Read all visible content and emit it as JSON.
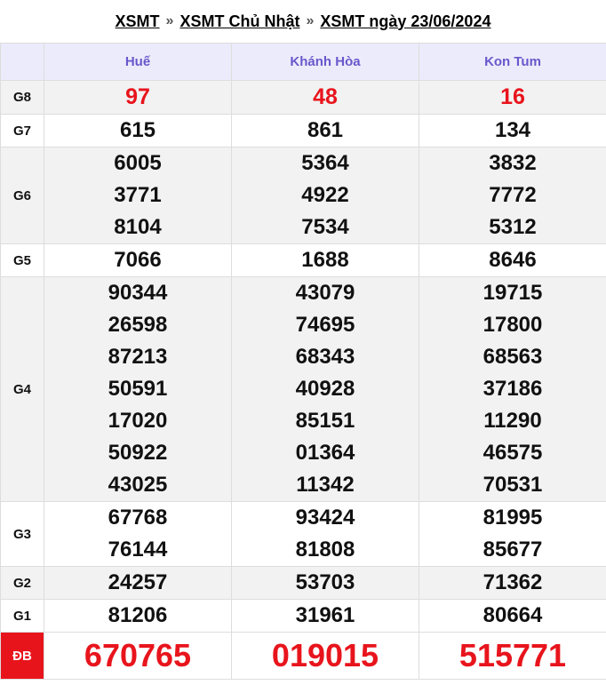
{
  "breadcrumb": {
    "link1": "XSMT",
    "sep1": "»",
    "link2": "XSMT Chủ Nhật",
    "sep2": "»",
    "link3": "XSMT ngày 23/06/2024"
  },
  "table": {
    "provinces": [
      "Huế",
      "Khánh Hòa",
      "Kon Tum"
    ],
    "prizes": [
      {
        "label": "G8",
        "values": [
          [
            "97"
          ],
          [
            "48"
          ],
          [
            "16"
          ]
        ]
      },
      {
        "label": "G7",
        "values": [
          [
            "615"
          ],
          [
            "861"
          ],
          [
            "134"
          ]
        ]
      },
      {
        "label": "G6",
        "values": [
          [
            "6005",
            "3771",
            "8104"
          ],
          [
            "5364",
            "4922",
            "7534"
          ],
          [
            "3832",
            "7772",
            "5312"
          ]
        ]
      },
      {
        "label": "G5",
        "values": [
          [
            "7066"
          ],
          [
            "1688"
          ],
          [
            "8646"
          ]
        ]
      },
      {
        "label": "G4",
        "values": [
          [
            "90344",
            "26598",
            "87213",
            "50591",
            "17020",
            "50922",
            "43025"
          ],
          [
            "43079",
            "74695",
            "68343",
            "40928",
            "85151",
            "01364",
            "11342"
          ],
          [
            "19715",
            "17800",
            "68563",
            "37186",
            "11290",
            "46575",
            "70531"
          ]
        ]
      },
      {
        "label": "G3",
        "values": [
          [
            "67768",
            "76144"
          ],
          [
            "93424",
            "81808"
          ],
          [
            "81995",
            "85677"
          ]
        ]
      },
      {
        "label": "G2",
        "values": [
          [
            "24257"
          ],
          [
            "53703"
          ],
          [
            "71362"
          ]
        ]
      },
      {
        "label": "G1",
        "values": [
          [
            "81206"
          ],
          [
            "31961"
          ],
          [
            "80664"
          ]
        ]
      },
      {
        "label": "ĐB",
        "values": [
          [
            "670765"
          ],
          [
            "019015"
          ],
          [
            "515771"
          ]
        ]
      }
    ]
  },
  "colors": {
    "header_bg": "#ecebfb",
    "header_text": "#6a57cc",
    "accent_red": "#e8141c",
    "alt_row": "#f2f2f2"
  }
}
